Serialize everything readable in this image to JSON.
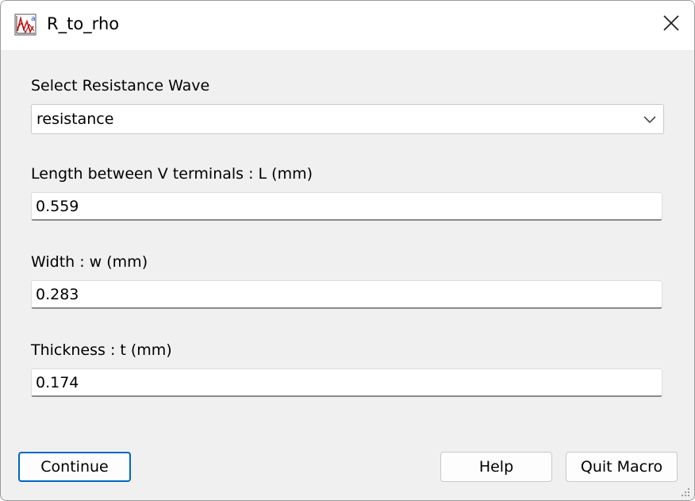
{
  "window": {
    "title": "R_to_rho",
    "app_icon": "graph-icon",
    "close_icon": "close-icon"
  },
  "form": {
    "wave": {
      "label": "Select Resistance Wave",
      "value": "resistance"
    },
    "length": {
      "label": "Length between V terminals : L (mm)",
      "value": "0.559"
    },
    "width": {
      "label": "Width : w (mm)",
      "value": "0.283"
    },
    "thickness": {
      "label": "Thickness : t (mm)",
      "value": "0.174"
    }
  },
  "buttons": {
    "continue": "Continue",
    "help": "Help",
    "quit": "Quit Macro"
  },
  "colors": {
    "accent": "#0067c0",
    "background": "#f0f0f0"
  }
}
